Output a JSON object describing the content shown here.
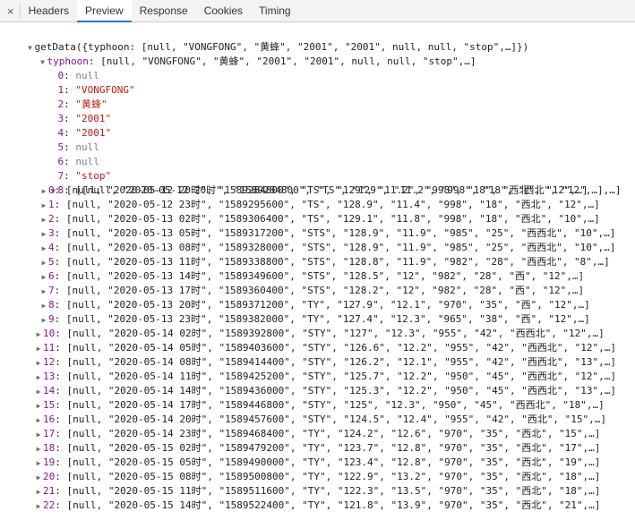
{
  "tabs": {
    "close": "×",
    "headers": "Headers",
    "preview": "Preview",
    "response": "Response",
    "cookies": "Cookies",
    "timing": "Timing"
  },
  "tree": {
    "root_summary": "getData({typhoon: [null, \"VONGFONG\", \"黄蜂\", \"2001\", \"2001\", null, null, \"stop\",…]})",
    "typhoon_key": "typhoon",
    "typhoon_summary": "[null, \"VONGFONG\", \"黄蜂\", \"2001\", \"2001\", null, null, \"stop\",…]",
    "items": [
      {
        "key": "0",
        "value": "null"
      },
      {
        "key": "1",
        "value": "\"VONGFONG\""
      },
      {
        "key": "2",
        "value": "\"黄蜂\""
      },
      {
        "key": "3",
        "value": "\"2001\""
      },
      {
        "key": "4",
        "value": "\"2001\""
      },
      {
        "key": "5",
        "value": "null"
      },
      {
        "key": "6",
        "value": "null"
      },
      {
        "key": "7",
        "value": "\"stop\""
      }
    ],
    "track_key": "8",
    "track_summary": "[[null, \"2020-05-12 20时\", \"1589284800\", \"TS\", \"129\", \"11.2\", \"998\", \"18\", \"西北\", \"12\",…],…]",
    "track_rows": [
      {
        "key": "0",
        "value": "[null, \"2020-05-12 20时\", \"1589284800\", \"TS\", \"129\", \"11.2\", \"998\", \"18\", \"西北\", \"12\",…]"
      },
      {
        "key": "1",
        "value": "[null, \"2020-05-12 23时\", \"1589295600\", \"TS\", \"128.9\", \"11.4\", \"998\", \"18\", \"西北\", \"12\",…]"
      },
      {
        "key": "2",
        "value": "[null, \"2020-05-13 02时\", \"1589306400\", \"TS\", \"129.1\", \"11.8\", \"998\", \"18\", \"西北\", \"10\",…]"
      },
      {
        "key": "3",
        "value": "[null, \"2020-05-13 05时\", \"1589317200\", \"STS\", \"128.9\", \"11.9\", \"985\", \"25\", \"西西北\", \"10\",…]"
      },
      {
        "key": "4",
        "value": "[null, \"2020-05-13 08时\", \"1589328000\", \"STS\", \"128.9\", \"11.9\", \"985\", \"25\", \"西西北\", \"10\",…]"
      },
      {
        "key": "5",
        "value": "[null, \"2020-05-13 11时\", \"1589338800\", \"STS\", \"128.8\", \"11.9\", \"982\", \"28\", \"西西北\", \"8\",…]"
      },
      {
        "key": "6",
        "value": "[null, \"2020-05-13 14时\", \"1589349600\", \"STS\", \"128.5\", \"12\", \"982\", \"28\", \"西\", \"12\",…]"
      },
      {
        "key": "7",
        "value": "[null, \"2020-05-13 17时\", \"1589360400\", \"STS\", \"128.2\", \"12\", \"982\", \"28\", \"西\", \"12\",…]"
      },
      {
        "key": "8",
        "value": "[null, \"2020-05-13 20时\", \"1589371200\", \"TY\", \"127.9\", \"12.1\", \"970\", \"35\", \"西\", \"12\",…]"
      },
      {
        "key": "9",
        "value": "[null, \"2020-05-13 23时\", \"1589382000\", \"TY\", \"127.4\", \"12.3\", \"965\", \"38\", \"西\", \"12\",…]"
      },
      {
        "key": "10",
        "value": "[null, \"2020-05-14 02时\", \"1589392800\", \"STY\", \"127\", \"12.3\", \"955\", \"42\", \"西西北\", \"12\",…]"
      },
      {
        "key": "11",
        "value": "[null, \"2020-05-14 05时\", \"1589403600\", \"STY\", \"126.6\", \"12.2\", \"955\", \"42\", \"西西北\", \"12\",…]"
      },
      {
        "key": "12",
        "value": "[null, \"2020-05-14 08时\", \"1589414400\", \"STY\", \"126.2\", \"12.1\", \"955\", \"42\", \"西西北\", \"13\",…]"
      },
      {
        "key": "13",
        "value": "[null, \"2020-05-14 11时\", \"1589425200\", \"STY\", \"125.7\", \"12.2\", \"950\", \"45\", \"西西北\", \"12\",…]"
      },
      {
        "key": "14",
        "value": "[null, \"2020-05-14 14时\", \"1589436000\", \"STY\", \"125.3\", \"12.2\", \"950\", \"45\", \"西西北\", \"13\",…]"
      },
      {
        "key": "15",
        "value": "[null, \"2020-05-14 17时\", \"1589446800\", \"STY\", \"125\", \"12.3\", \"950\", \"45\", \"西西北\", \"18\",…]"
      },
      {
        "key": "16",
        "value": "[null, \"2020-05-14 20时\", \"1589457600\", \"STY\", \"124.5\", \"12.4\", \"955\", \"42\", \"西北\", \"15\",…]"
      },
      {
        "key": "17",
        "value": "[null, \"2020-05-14 23时\", \"1589468400\", \"TY\", \"124.2\", \"12.6\", \"970\", \"35\", \"西北\", \"15\",…]"
      },
      {
        "key": "18",
        "value": "[null, \"2020-05-15 02时\", \"1589479200\", \"TY\", \"123.7\", \"12.8\", \"970\", \"35\", \"西北\", \"17\",…]"
      },
      {
        "key": "19",
        "value": "[null, \"2020-05-15 05时\", \"1589490000\", \"TY\", \"123.4\", \"12.8\", \"970\", \"35\", \"西北\", \"19\",…]"
      },
      {
        "key": "20",
        "value": "[null, \"2020-05-15 08时\", \"1589500800\", \"TY\", \"122.9\", \"13.2\", \"970\", \"35\", \"西北\", \"18\",…]"
      },
      {
        "key": "21",
        "value": "[null, \"2020-05-15 11时\", \"1589511600\", \"TY\", \"122.3\", \"13.5\", \"970\", \"35\", \"西北\", \"18\",…]"
      },
      {
        "key": "22",
        "value": "[null, \"2020-05-15 14时\", \"1589522400\", \"TY\", \"121.8\", \"13.9\", \"970\", \"35\", \"西北\", \"21\",…]"
      }
    ]
  }
}
